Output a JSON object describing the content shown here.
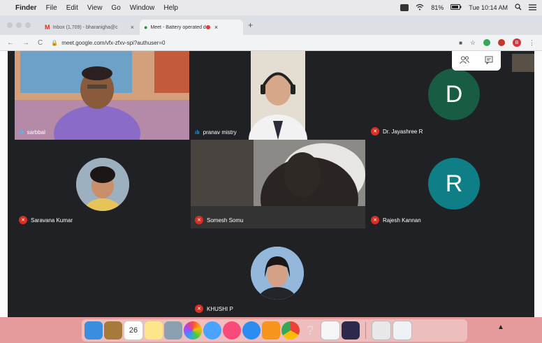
{
  "menubar": {
    "app": "Finder",
    "items": [
      "File",
      "Edit",
      "View",
      "Go",
      "Window",
      "Help"
    ],
    "battery": "81%",
    "clock": "Tue 10:14 AM"
  },
  "tabs": [
    {
      "favicon": "M",
      "title": "Inbox (1,709) - bharanigha@c",
      "close": "×"
    },
    {
      "favicon": "●",
      "title": "Meet - Battery operated d",
      "close": "×"
    }
  ],
  "newtab_label": "+",
  "address": {
    "url": "meet.google.com/vfx-zfxv-spi?authuser=0",
    "profile_letter": "B"
  },
  "meeting": {
    "participants": [
      {
        "name": "sarbbal",
        "muted": false
      },
      {
        "name": "pranav mistry",
        "muted": false
      },
      {
        "name": "Dr. Jayashree R",
        "muted": true,
        "initial": "D",
        "color": "#185c43"
      },
      {
        "name": "Saravana Kumar",
        "muted": true
      },
      {
        "name": "Somesh Somu",
        "muted": true
      },
      {
        "name": "Rajesh Kannan",
        "muted": true,
        "initial": "R",
        "color": "#0f7f87"
      },
      {
        "name": "KHUSHI P",
        "muted": true
      }
    ]
  },
  "dock": {
    "calendar_day": "26",
    "help_glyph": "?"
  }
}
